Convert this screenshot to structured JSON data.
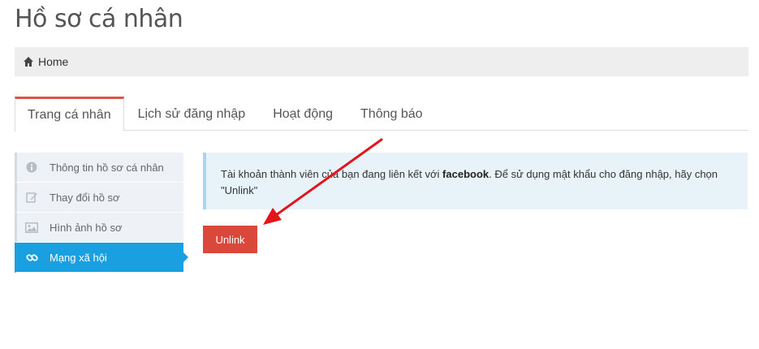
{
  "page": {
    "title": "Hồ sơ cá nhân"
  },
  "breadcrumb": {
    "home_label": "Home",
    "icon": "home-icon"
  },
  "tabs": [
    {
      "label": "Trang cá nhân",
      "active": true
    },
    {
      "label": "Lịch sử đăng nhập",
      "active": false
    },
    {
      "label": "Hoạt động",
      "active": false
    },
    {
      "label": "Thông báo",
      "active": false
    }
  ],
  "side_menu": [
    {
      "label": "Thông tin hồ sơ cá nhân",
      "icon": "info-icon",
      "active": false
    },
    {
      "label": "Thay đổi hồ sơ",
      "icon": "edit-icon",
      "active": false
    },
    {
      "label": "Hình ảnh hồ sơ",
      "icon": "image-icon",
      "active": false
    },
    {
      "label": "Mạng xã hội",
      "icon": "link-icon",
      "active": true
    }
  ],
  "alert": {
    "text_before": "Tài khoản thành viên của bạn đang liên kết với ",
    "provider": "facebook",
    "text_after": ". Để sử dụng mật khẩu cho đăng nhập, hãy chọn \"Unlink\""
  },
  "actions": {
    "unlink_label": "Unlink"
  },
  "colors": {
    "accent_red": "#d9483b",
    "active_blue": "#1a9fe0",
    "alert_bg": "#e7f3f9",
    "arrow_red": "#e3141b"
  }
}
